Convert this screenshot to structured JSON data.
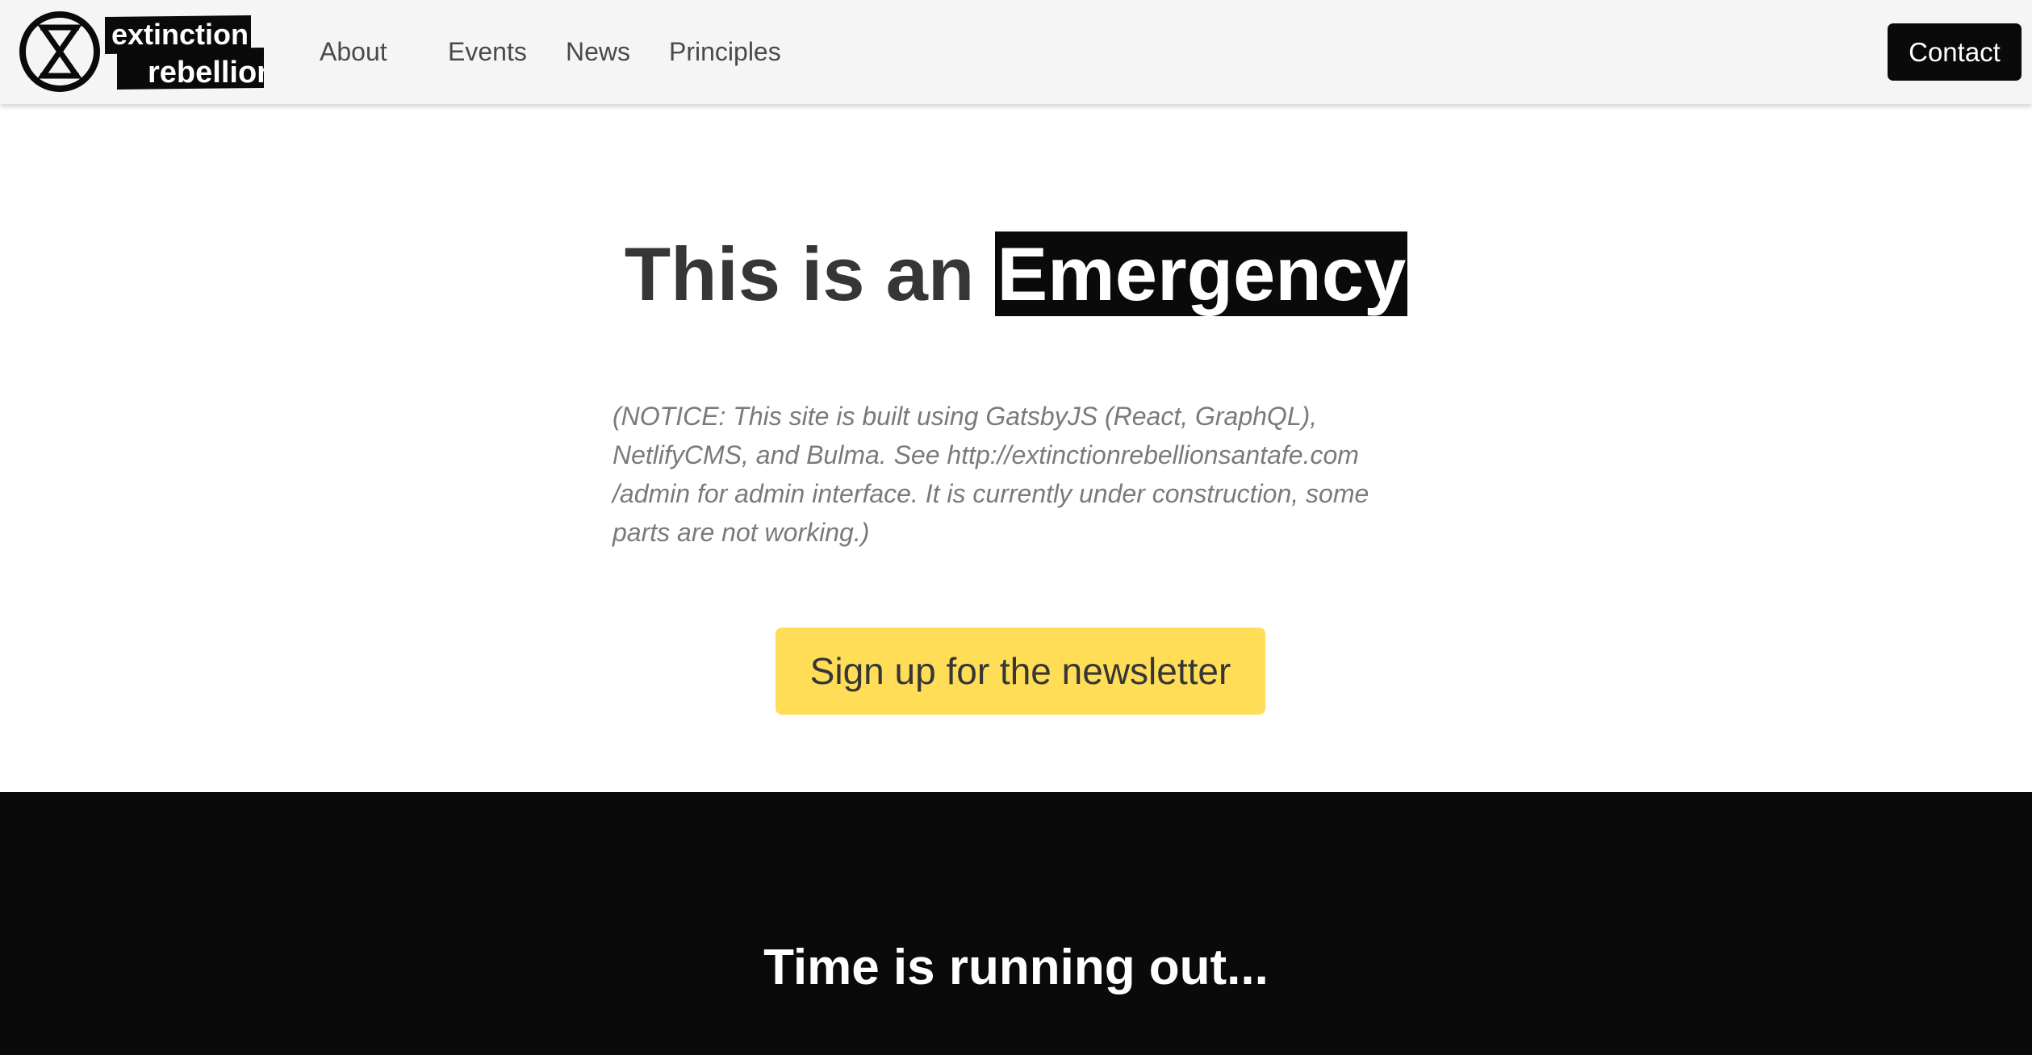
{
  "brand": {
    "logo_line1": "extinction",
    "logo_line2": "rebellion",
    "icon": "hourglass-circle-icon"
  },
  "nav": {
    "items": [
      {
        "label": "About"
      },
      {
        "label": "Events"
      },
      {
        "label": "News"
      },
      {
        "label": "Principles"
      }
    ],
    "contact_label": "Contact"
  },
  "hero": {
    "title_prefix": "This is an ",
    "title_highlight": "Emergency",
    "notice": "(NOTICE: This site is built using GatsbyJS (React, GraphQL), NetlifyCMS, and Bulma. See http://extinctionrebellionsantafe.com /admin for admin interface. It is currently under construction, some parts are not working.)",
    "cta_label": "Sign up for the newsletter"
  },
  "section": {
    "title": "Time is running out..."
  },
  "colors": {
    "navbar_bg": "#f5f5f5",
    "text": "#363636",
    "nav_text": "#4a4a4a",
    "notice_text": "#7a7a7a",
    "black": "#0a0a0a",
    "cta_yellow": "#ffdd57"
  }
}
